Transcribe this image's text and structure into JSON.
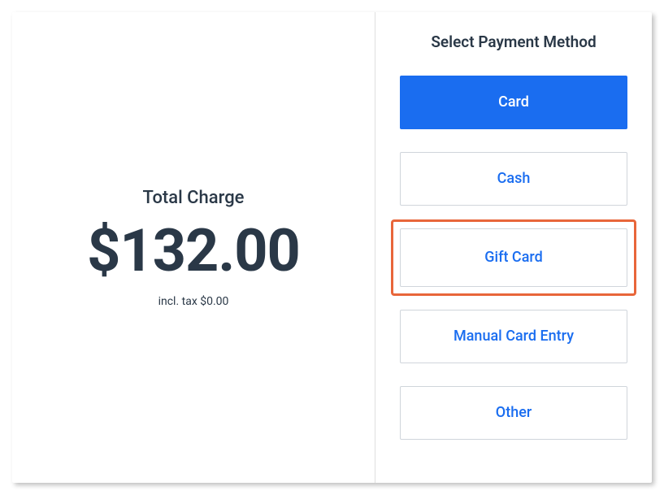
{
  "charge": {
    "label": "Total Charge",
    "amount": "$132.00",
    "tax_info": "incl. tax $0.00"
  },
  "payment": {
    "header": "Select Payment Method",
    "options": {
      "card": "Card",
      "cash": "Cash",
      "gift_card": "Gift Card",
      "manual_entry": "Manual Card Entry",
      "other": "Other"
    }
  }
}
